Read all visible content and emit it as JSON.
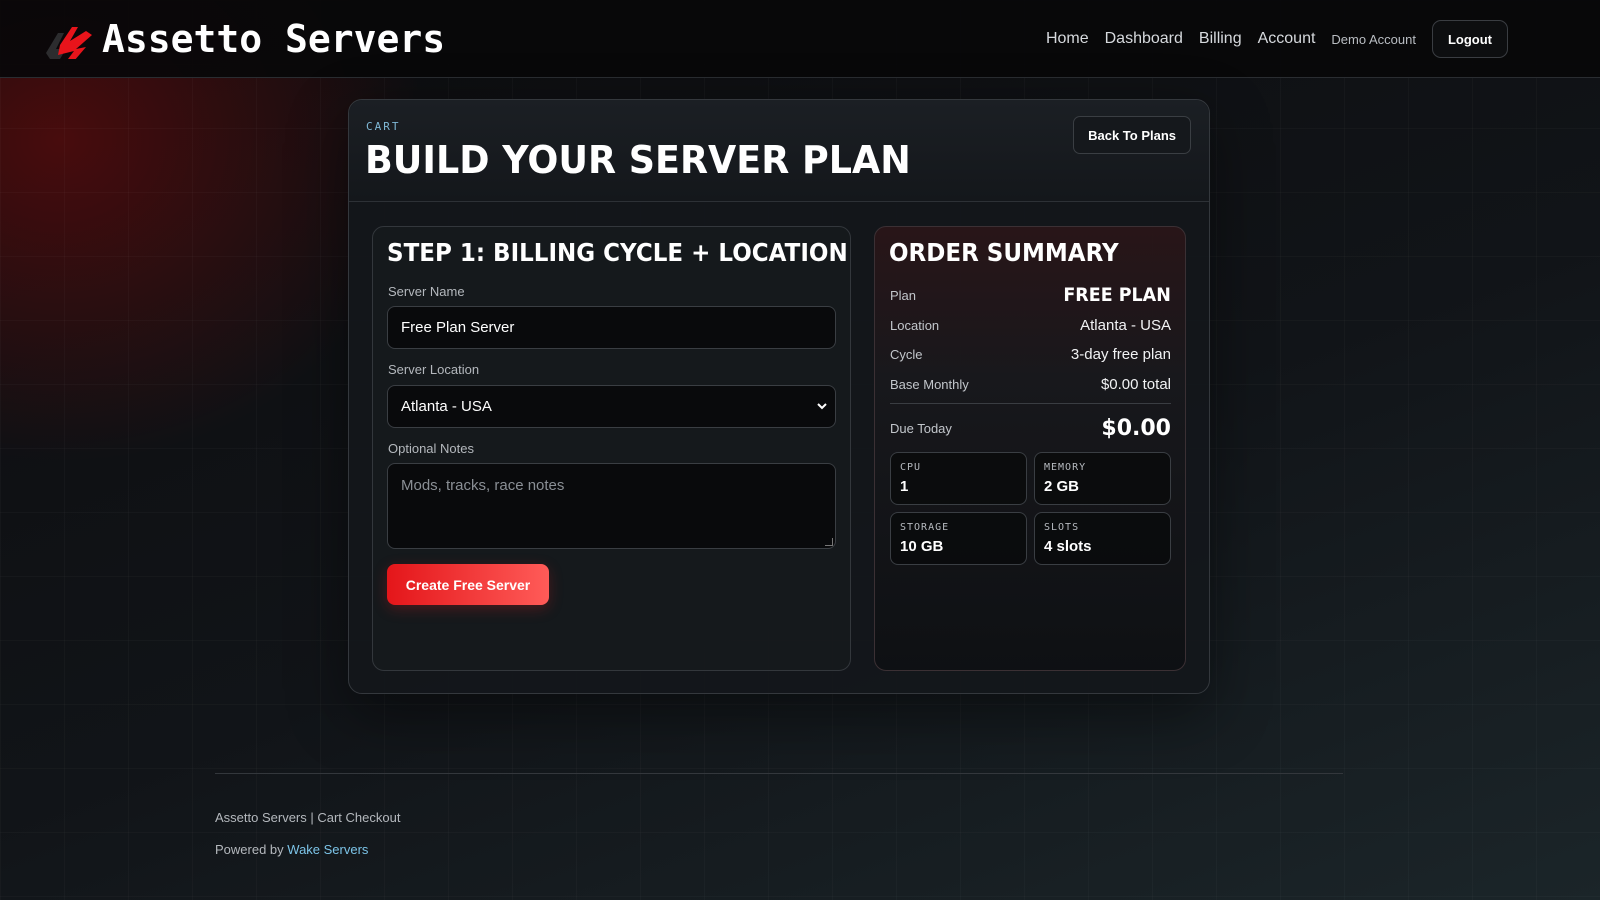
{
  "header": {
    "brand": "Assetto Servers",
    "nav": [
      "Home",
      "Dashboard",
      "Billing",
      "Account"
    ],
    "account_name": "Demo Account",
    "logout_label": "Logout"
  },
  "page": {
    "eyebrow": "CART",
    "title": "BUILD YOUR SERVER PLAN",
    "back_label": "Back To Plans"
  },
  "step": {
    "title": "STEP 1: BILLING CYCLE + LOCATION",
    "server_name_label": "Server Name",
    "server_name_value": "Free Plan Server",
    "location_label": "Server Location",
    "location_value": "Atlanta - USA",
    "notes_label": "Optional Notes",
    "notes_placeholder": "Mods, tracks, race notes",
    "submit_label": "Create Free Server"
  },
  "summary": {
    "title": "ORDER SUMMARY",
    "rows": [
      {
        "label": "Plan",
        "value": "FREE PLAN"
      },
      {
        "label": "Location",
        "value": "Atlanta - USA"
      },
      {
        "label": "Cycle",
        "value": "3-day free plan"
      },
      {
        "label": "Base Monthly",
        "value": "$0.00 total"
      }
    ],
    "due_label": "Due Today",
    "due_value": "$0.00",
    "specs": [
      {
        "label": "CPU",
        "value": "1"
      },
      {
        "label": "MEMORY",
        "value": "2 GB"
      },
      {
        "label": "STORAGE",
        "value": "10 GB"
      },
      {
        "label": "SLOTS",
        "value": "4 slots"
      }
    ]
  },
  "footer": {
    "line1": "Assetto Servers | Cart Checkout",
    "powered_prefix": "Powered by",
    "powered_link": "Wake Servers"
  },
  "colors": {
    "accent_red": "#e4161a",
    "link_blue": "#7cc4e8",
    "eyebrow_blue": "#7fb8d6"
  }
}
